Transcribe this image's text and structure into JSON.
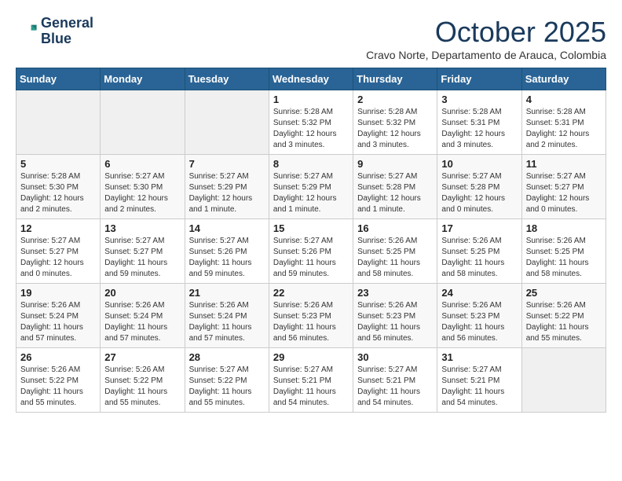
{
  "header": {
    "logo_line1": "General",
    "logo_line2": "Blue",
    "month_title": "October 2025",
    "subtitle": "Cravo Norte, Departamento de Arauca, Colombia"
  },
  "weekdays": [
    "Sunday",
    "Monday",
    "Tuesday",
    "Wednesday",
    "Thursday",
    "Friday",
    "Saturday"
  ],
  "weeks": [
    [
      {
        "day": "",
        "info": ""
      },
      {
        "day": "",
        "info": ""
      },
      {
        "day": "",
        "info": ""
      },
      {
        "day": "1",
        "info": "Sunrise: 5:28 AM\nSunset: 5:32 PM\nDaylight: 12 hours\nand 3 minutes."
      },
      {
        "day": "2",
        "info": "Sunrise: 5:28 AM\nSunset: 5:32 PM\nDaylight: 12 hours\nand 3 minutes."
      },
      {
        "day": "3",
        "info": "Sunrise: 5:28 AM\nSunset: 5:31 PM\nDaylight: 12 hours\nand 3 minutes."
      },
      {
        "day": "4",
        "info": "Sunrise: 5:28 AM\nSunset: 5:31 PM\nDaylight: 12 hours\nand 2 minutes."
      }
    ],
    [
      {
        "day": "5",
        "info": "Sunrise: 5:28 AM\nSunset: 5:30 PM\nDaylight: 12 hours\nand 2 minutes."
      },
      {
        "day": "6",
        "info": "Sunrise: 5:27 AM\nSunset: 5:30 PM\nDaylight: 12 hours\nand 2 minutes."
      },
      {
        "day": "7",
        "info": "Sunrise: 5:27 AM\nSunset: 5:29 PM\nDaylight: 12 hours\nand 1 minute."
      },
      {
        "day": "8",
        "info": "Sunrise: 5:27 AM\nSunset: 5:29 PM\nDaylight: 12 hours\nand 1 minute."
      },
      {
        "day": "9",
        "info": "Sunrise: 5:27 AM\nSunset: 5:28 PM\nDaylight: 12 hours\nand 1 minute."
      },
      {
        "day": "10",
        "info": "Sunrise: 5:27 AM\nSunset: 5:28 PM\nDaylight: 12 hours\nand 0 minutes."
      },
      {
        "day": "11",
        "info": "Sunrise: 5:27 AM\nSunset: 5:27 PM\nDaylight: 12 hours\nand 0 minutes."
      }
    ],
    [
      {
        "day": "12",
        "info": "Sunrise: 5:27 AM\nSunset: 5:27 PM\nDaylight: 12 hours\nand 0 minutes."
      },
      {
        "day": "13",
        "info": "Sunrise: 5:27 AM\nSunset: 5:27 PM\nDaylight: 11 hours\nand 59 minutes."
      },
      {
        "day": "14",
        "info": "Sunrise: 5:27 AM\nSunset: 5:26 PM\nDaylight: 11 hours\nand 59 minutes."
      },
      {
        "day": "15",
        "info": "Sunrise: 5:27 AM\nSunset: 5:26 PM\nDaylight: 11 hours\nand 59 minutes."
      },
      {
        "day": "16",
        "info": "Sunrise: 5:26 AM\nSunset: 5:25 PM\nDaylight: 11 hours\nand 58 minutes."
      },
      {
        "day": "17",
        "info": "Sunrise: 5:26 AM\nSunset: 5:25 PM\nDaylight: 11 hours\nand 58 minutes."
      },
      {
        "day": "18",
        "info": "Sunrise: 5:26 AM\nSunset: 5:25 PM\nDaylight: 11 hours\nand 58 minutes."
      }
    ],
    [
      {
        "day": "19",
        "info": "Sunrise: 5:26 AM\nSunset: 5:24 PM\nDaylight: 11 hours\nand 57 minutes."
      },
      {
        "day": "20",
        "info": "Sunrise: 5:26 AM\nSunset: 5:24 PM\nDaylight: 11 hours\nand 57 minutes."
      },
      {
        "day": "21",
        "info": "Sunrise: 5:26 AM\nSunset: 5:24 PM\nDaylight: 11 hours\nand 57 minutes."
      },
      {
        "day": "22",
        "info": "Sunrise: 5:26 AM\nSunset: 5:23 PM\nDaylight: 11 hours\nand 56 minutes."
      },
      {
        "day": "23",
        "info": "Sunrise: 5:26 AM\nSunset: 5:23 PM\nDaylight: 11 hours\nand 56 minutes."
      },
      {
        "day": "24",
        "info": "Sunrise: 5:26 AM\nSunset: 5:23 PM\nDaylight: 11 hours\nand 56 minutes."
      },
      {
        "day": "25",
        "info": "Sunrise: 5:26 AM\nSunset: 5:22 PM\nDaylight: 11 hours\nand 55 minutes."
      }
    ],
    [
      {
        "day": "26",
        "info": "Sunrise: 5:26 AM\nSunset: 5:22 PM\nDaylight: 11 hours\nand 55 minutes."
      },
      {
        "day": "27",
        "info": "Sunrise: 5:26 AM\nSunset: 5:22 PM\nDaylight: 11 hours\nand 55 minutes."
      },
      {
        "day": "28",
        "info": "Sunrise: 5:27 AM\nSunset: 5:22 PM\nDaylight: 11 hours\nand 55 minutes."
      },
      {
        "day": "29",
        "info": "Sunrise: 5:27 AM\nSunset: 5:21 PM\nDaylight: 11 hours\nand 54 minutes."
      },
      {
        "day": "30",
        "info": "Sunrise: 5:27 AM\nSunset: 5:21 PM\nDaylight: 11 hours\nand 54 minutes."
      },
      {
        "day": "31",
        "info": "Sunrise: 5:27 AM\nSunset: 5:21 PM\nDaylight: 11 hours\nand 54 minutes."
      },
      {
        "day": "",
        "info": ""
      }
    ]
  ]
}
